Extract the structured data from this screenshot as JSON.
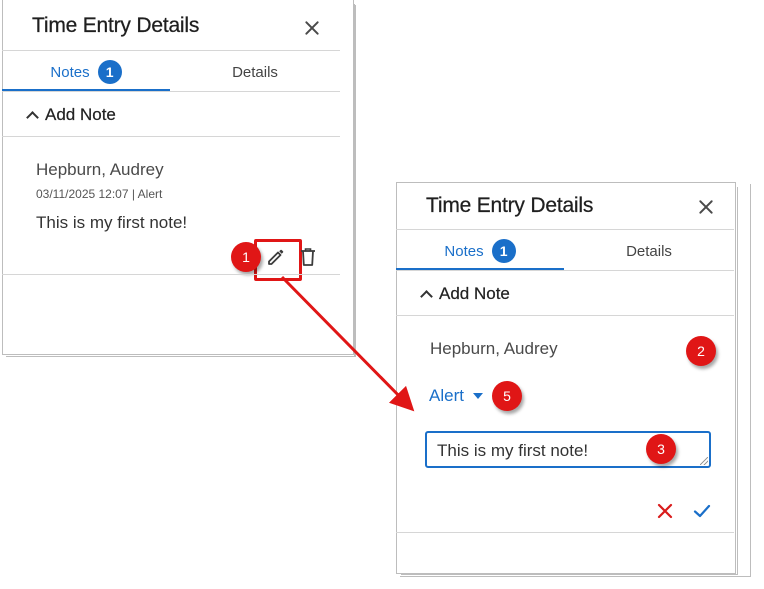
{
  "left_panel": {
    "title": "Time Entry Details",
    "tabs": [
      {
        "label": "Notes",
        "badge": "1"
      },
      {
        "label": "Details"
      }
    ],
    "section_label": "Add Note",
    "note": {
      "author": "Hepburn, Audrey",
      "meta": "03/11/2025 12:07 | Alert",
      "text": "This is my first note!"
    }
  },
  "right_panel": {
    "title": "Time Entry Details",
    "tabs": [
      {
        "label": "Notes",
        "badge": "1"
      },
      {
        "label": "Details"
      }
    ],
    "section_label": "Add Note",
    "edit": {
      "author": "Hepburn, Audrey",
      "type_value": "Alert",
      "note_value": "This is my first note!"
    }
  },
  "steps": {
    "s1": "1",
    "s2": "2",
    "s3": "3",
    "s5": "5"
  },
  "colors": {
    "accent": "#1a6fc9",
    "annotation": "#e01616"
  }
}
